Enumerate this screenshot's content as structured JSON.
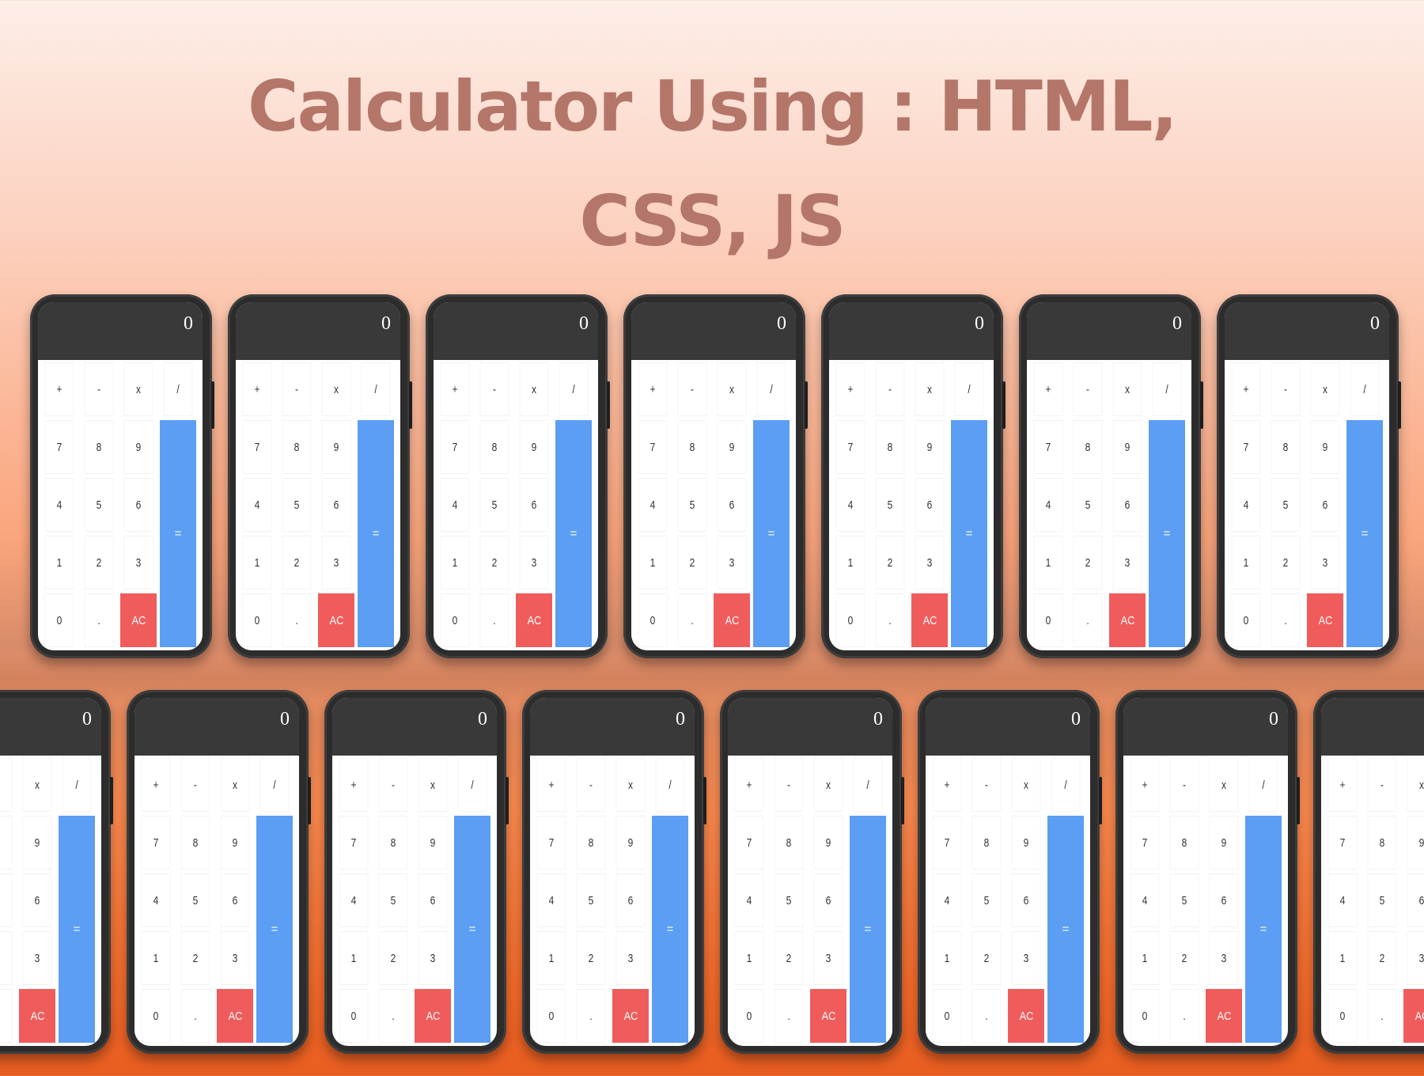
{
  "title": {
    "line1": "Calculator Using : HTML,",
    "line2": "CSS, JS"
  },
  "calculator": {
    "display_value": "0",
    "keys": [
      "+",
      "-",
      "x",
      "/",
      "7",
      "8",
      "9",
      "4",
      "5",
      "6",
      "1",
      "2",
      "3",
      "0",
      ".",
      "AC",
      "="
    ]
  },
  "colors": {
    "title": "#b5766a",
    "display_bg": "#393939",
    "equals_key": "#5b9ef3",
    "clear_key": "#f05c5c",
    "phone_frame": "#2c2c2c"
  }
}
